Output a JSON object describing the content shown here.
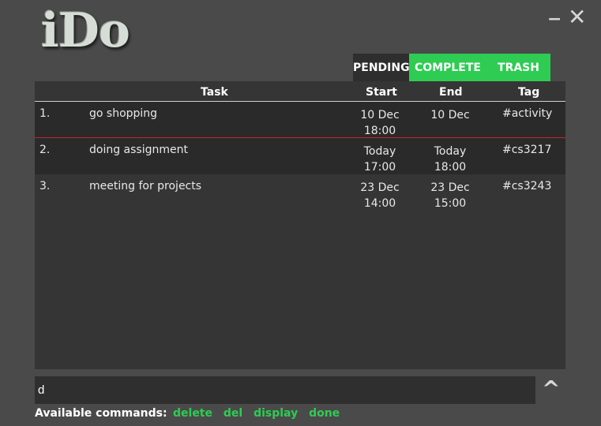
{
  "app": {
    "logo": "iDo",
    "minimize_glyph": "−",
    "close_glyph": "✕"
  },
  "tabs": [
    {
      "label": "PENDING",
      "state": "active"
    },
    {
      "label": "COMPLETE"
    },
    {
      "label": "TRASH"
    }
  ],
  "table": {
    "headers": {
      "task": "Task",
      "start": "Start",
      "end": "End",
      "tag": "Tag"
    },
    "rows": [
      {
        "num": "1.",
        "task": "go shopping",
        "start_date": "10 Dec",
        "start_time": "18:00",
        "end_date": "10 Dec",
        "end_time": "",
        "tag": "#activity"
      },
      {
        "num": "2.",
        "task": "doing assignment",
        "start_date": "Today",
        "start_time": "17:00",
        "end_date": "Today",
        "end_time": "18:00",
        "tag": "#cs3217"
      },
      {
        "num": "3.",
        "task": "meeting for projects",
        "start_date": "23 Dec",
        "start_time": "14:00",
        "end_date": "23 Dec",
        "end_time": "15:00",
        "tag": "#cs3243"
      }
    ]
  },
  "command": {
    "value": "d",
    "up_glyph": "^"
  },
  "available": {
    "label": "Available commands:",
    "commands": [
      "delete",
      "del",
      "display",
      "done"
    ]
  },
  "colors": {
    "accent_green": "#2ecc52",
    "selection_red": "#c0272d",
    "background": "#4a4a4a"
  }
}
